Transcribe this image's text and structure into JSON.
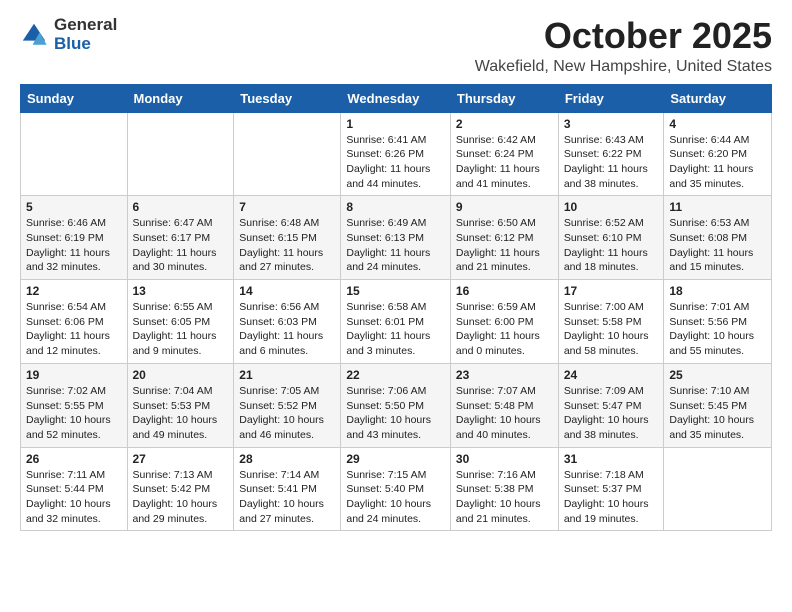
{
  "logo": {
    "general": "General",
    "blue": "Blue"
  },
  "title": "October 2025",
  "location": "Wakefield, New Hampshire, United States",
  "days_of_week": [
    "Sunday",
    "Monday",
    "Tuesday",
    "Wednesday",
    "Thursday",
    "Friday",
    "Saturday"
  ],
  "weeks": [
    [
      {
        "day": "",
        "content": ""
      },
      {
        "day": "",
        "content": ""
      },
      {
        "day": "",
        "content": ""
      },
      {
        "day": "1",
        "content": "Sunrise: 6:41 AM\nSunset: 6:26 PM\nDaylight: 11 hours\nand 44 minutes."
      },
      {
        "day": "2",
        "content": "Sunrise: 6:42 AM\nSunset: 6:24 PM\nDaylight: 11 hours\nand 41 minutes."
      },
      {
        "day": "3",
        "content": "Sunrise: 6:43 AM\nSunset: 6:22 PM\nDaylight: 11 hours\nand 38 minutes."
      },
      {
        "day": "4",
        "content": "Sunrise: 6:44 AM\nSunset: 6:20 PM\nDaylight: 11 hours\nand 35 minutes."
      }
    ],
    [
      {
        "day": "5",
        "content": "Sunrise: 6:46 AM\nSunset: 6:19 PM\nDaylight: 11 hours\nand 32 minutes."
      },
      {
        "day": "6",
        "content": "Sunrise: 6:47 AM\nSunset: 6:17 PM\nDaylight: 11 hours\nand 30 minutes."
      },
      {
        "day": "7",
        "content": "Sunrise: 6:48 AM\nSunset: 6:15 PM\nDaylight: 11 hours\nand 27 minutes."
      },
      {
        "day": "8",
        "content": "Sunrise: 6:49 AM\nSunset: 6:13 PM\nDaylight: 11 hours\nand 24 minutes."
      },
      {
        "day": "9",
        "content": "Sunrise: 6:50 AM\nSunset: 6:12 PM\nDaylight: 11 hours\nand 21 minutes."
      },
      {
        "day": "10",
        "content": "Sunrise: 6:52 AM\nSunset: 6:10 PM\nDaylight: 11 hours\nand 18 minutes."
      },
      {
        "day": "11",
        "content": "Sunrise: 6:53 AM\nSunset: 6:08 PM\nDaylight: 11 hours\nand 15 minutes."
      }
    ],
    [
      {
        "day": "12",
        "content": "Sunrise: 6:54 AM\nSunset: 6:06 PM\nDaylight: 11 hours\nand 12 minutes."
      },
      {
        "day": "13",
        "content": "Sunrise: 6:55 AM\nSunset: 6:05 PM\nDaylight: 11 hours\nand 9 minutes."
      },
      {
        "day": "14",
        "content": "Sunrise: 6:56 AM\nSunset: 6:03 PM\nDaylight: 11 hours\nand 6 minutes."
      },
      {
        "day": "15",
        "content": "Sunrise: 6:58 AM\nSunset: 6:01 PM\nDaylight: 11 hours\nand 3 minutes."
      },
      {
        "day": "16",
        "content": "Sunrise: 6:59 AM\nSunset: 6:00 PM\nDaylight: 11 hours\nand 0 minutes."
      },
      {
        "day": "17",
        "content": "Sunrise: 7:00 AM\nSunset: 5:58 PM\nDaylight: 10 hours\nand 58 minutes."
      },
      {
        "day": "18",
        "content": "Sunrise: 7:01 AM\nSunset: 5:56 PM\nDaylight: 10 hours\nand 55 minutes."
      }
    ],
    [
      {
        "day": "19",
        "content": "Sunrise: 7:02 AM\nSunset: 5:55 PM\nDaylight: 10 hours\nand 52 minutes."
      },
      {
        "day": "20",
        "content": "Sunrise: 7:04 AM\nSunset: 5:53 PM\nDaylight: 10 hours\nand 49 minutes."
      },
      {
        "day": "21",
        "content": "Sunrise: 7:05 AM\nSunset: 5:52 PM\nDaylight: 10 hours\nand 46 minutes."
      },
      {
        "day": "22",
        "content": "Sunrise: 7:06 AM\nSunset: 5:50 PM\nDaylight: 10 hours\nand 43 minutes."
      },
      {
        "day": "23",
        "content": "Sunrise: 7:07 AM\nSunset: 5:48 PM\nDaylight: 10 hours\nand 40 minutes."
      },
      {
        "day": "24",
        "content": "Sunrise: 7:09 AM\nSunset: 5:47 PM\nDaylight: 10 hours\nand 38 minutes."
      },
      {
        "day": "25",
        "content": "Sunrise: 7:10 AM\nSunset: 5:45 PM\nDaylight: 10 hours\nand 35 minutes."
      }
    ],
    [
      {
        "day": "26",
        "content": "Sunrise: 7:11 AM\nSunset: 5:44 PM\nDaylight: 10 hours\nand 32 minutes."
      },
      {
        "day": "27",
        "content": "Sunrise: 7:13 AM\nSunset: 5:42 PM\nDaylight: 10 hours\nand 29 minutes."
      },
      {
        "day": "28",
        "content": "Sunrise: 7:14 AM\nSunset: 5:41 PM\nDaylight: 10 hours\nand 27 minutes."
      },
      {
        "day": "29",
        "content": "Sunrise: 7:15 AM\nSunset: 5:40 PM\nDaylight: 10 hours\nand 24 minutes."
      },
      {
        "day": "30",
        "content": "Sunrise: 7:16 AM\nSunset: 5:38 PM\nDaylight: 10 hours\nand 21 minutes."
      },
      {
        "day": "31",
        "content": "Sunrise: 7:18 AM\nSunset: 5:37 PM\nDaylight: 10 hours\nand 19 minutes."
      },
      {
        "day": "",
        "content": ""
      }
    ]
  ]
}
